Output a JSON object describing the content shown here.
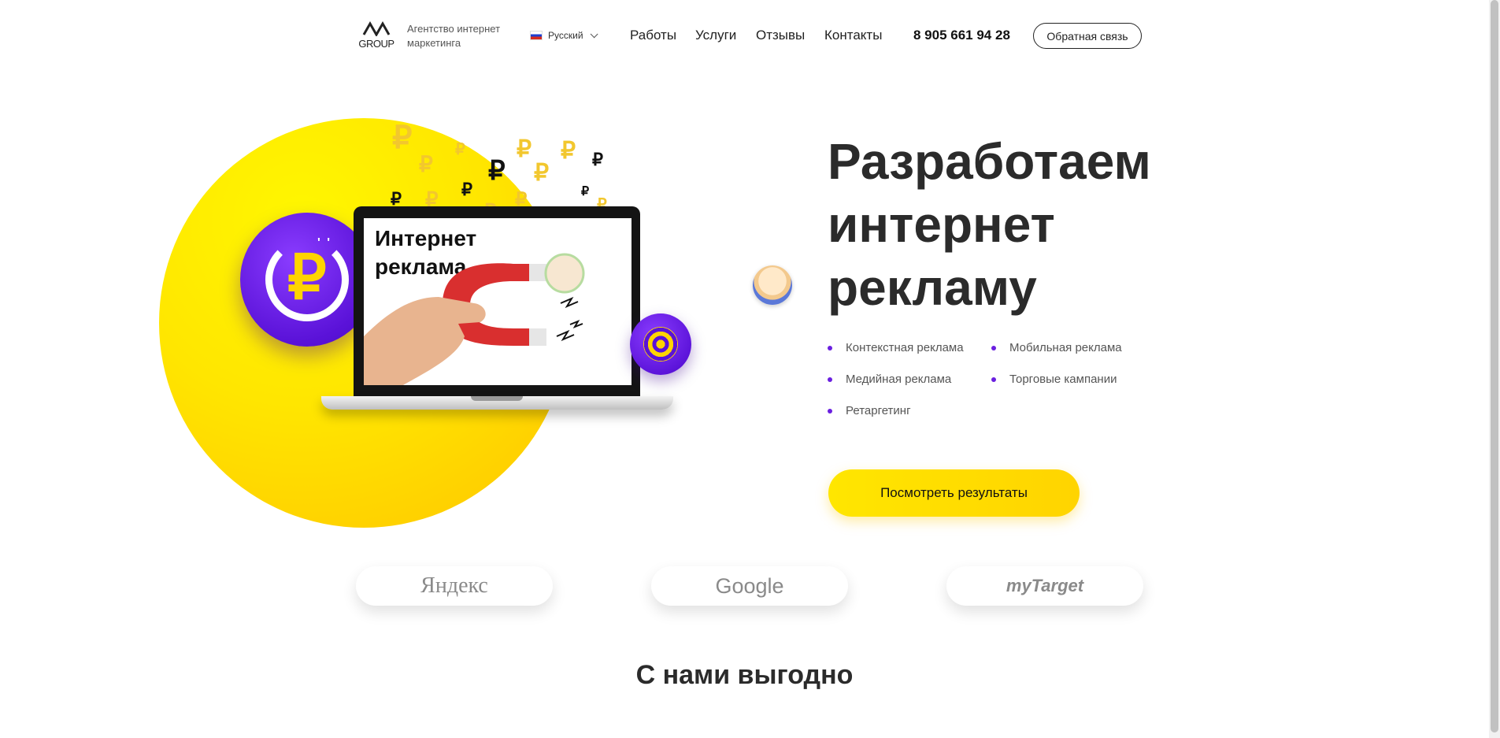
{
  "header": {
    "logo_text": "GROUP",
    "tagline": "Агентство интернет маркетинга",
    "language": "Русский",
    "nav": [
      "Работы",
      "Услуги",
      "Отзывы",
      "Контакты"
    ],
    "phone": "8 905 661 94 28",
    "feedback_label": "Обратная связь"
  },
  "hero": {
    "screen_title": "Интернет реклама",
    "title": "Разработаем интернет рекламу",
    "services": [
      "Контекстная реклама",
      "Мобильная реклама",
      "Медийная реклама",
      "Торговые кампании",
      "Ретаргетинг"
    ],
    "cta_label": "Посмотреть результаты",
    "currency_symbol": "₽",
    "coin_symbol": "₽",
    "accent_color": "#ffd400",
    "purple_color": "#5a12d8"
  },
  "partners": [
    "Яндекс",
    "Google",
    "myTarget"
  ],
  "section": {
    "title": "С нами выгодно"
  }
}
